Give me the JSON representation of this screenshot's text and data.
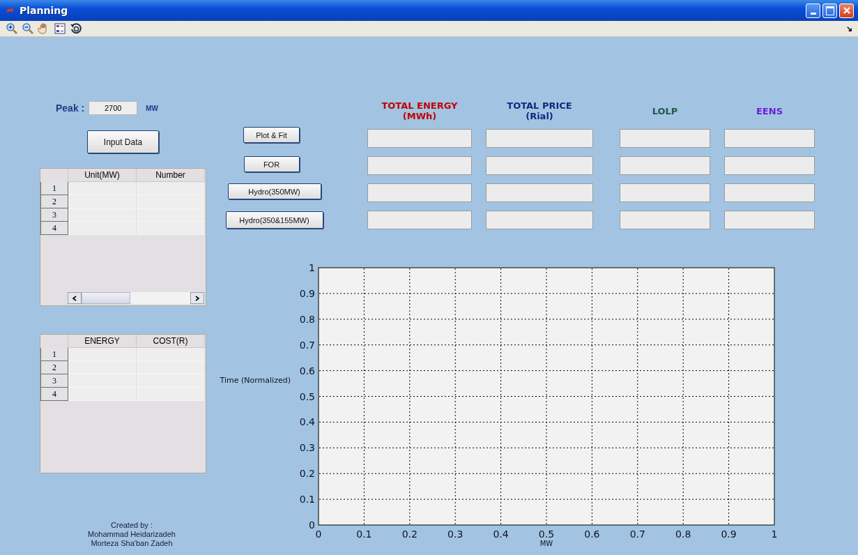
{
  "window": {
    "title": "Planning"
  },
  "peak": {
    "label": "Peak :",
    "value": "2700",
    "unit": "MW"
  },
  "input_button": "Input Data",
  "units_table": {
    "columns": [
      "Unit(MW)",
      "Number"
    ],
    "rows": [
      "1",
      "2",
      "3",
      "4"
    ]
  },
  "cost_table": {
    "columns": [
      "ENERGY",
      "COST(R)"
    ],
    "rows": [
      "1",
      "2",
      "3",
      "4"
    ]
  },
  "credits": [
    "Created by :",
    "Mohammad Heidarizadeh",
    "Morteza Sha'ban Zadeh"
  ],
  "buttons": [
    "Plot & Fit",
    "FOR",
    "Hydro(350MW)",
    "Hydro(350&155MW)"
  ],
  "results": [
    {
      "title": "TOTAL ENERGY",
      "unit": "(MWh)",
      "color": "#c00000"
    },
    {
      "title": "TOTAL PRICE",
      "unit": "(Rial)",
      "color": "#102a80"
    },
    {
      "title": "LOLP",
      "color": "#1d5a4a"
    },
    {
      "title": "EENS",
      "color": "#6a1fd0"
    }
  ],
  "chart": {
    "chart_data": {
      "type": "line",
      "xlabel": "MW",
      "ylabel": "Time (Normalized)",
      "xlim": [
        0,
        1
      ],
      "ylim": [
        0,
        1
      ],
      "xticks": [
        0,
        0.1,
        0.2,
        0.3,
        0.4,
        0.5,
        0.6,
        0.7,
        0.8,
        0.9,
        1
      ],
      "yticks": [
        0,
        0.1,
        0.2,
        0.3,
        0.4,
        0.5,
        0.6,
        0.7,
        0.8,
        0.9,
        1
      ],
      "grid": true
    }
  }
}
